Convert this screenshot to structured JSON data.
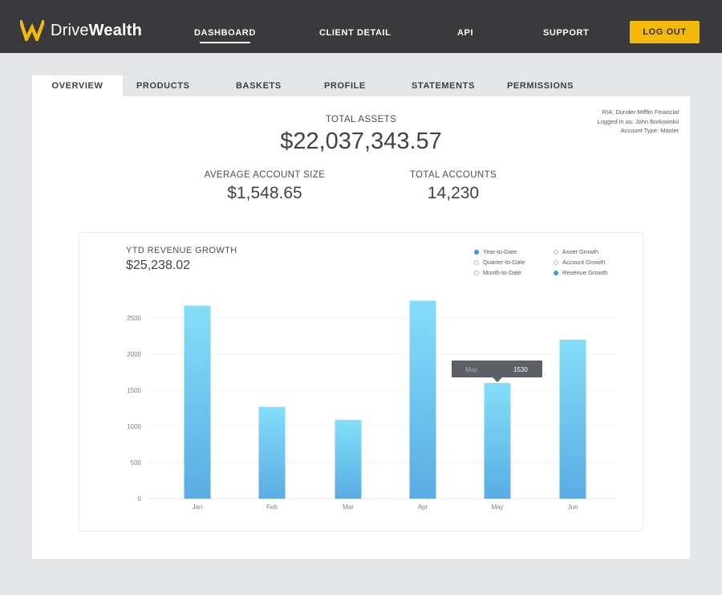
{
  "brand": {
    "name_light": "Drive",
    "name_bold": "Wealth",
    "accent": "#f6b90a"
  },
  "nav": {
    "links": [
      "DASHBOARD",
      "CLIENT DETAIL",
      "API",
      "SUPPORT"
    ],
    "active": "DASHBOARD",
    "logout_label": "LOG OUT"
  },
  "tabs": [
    "OVERVIEW",
    "PRODUCTS",
    "BASKETS",
    "PROFILE",
    "STATEMENTS",
    "PERMISSIONS"
  ],
  "active_tab": "OVERVIEW",
  "account": {
    "ria": "RIA: Dunder-Mifflin Financial",
    "logged_in": "Logged in as: John Borkowskil",
    "account_type": "Account Type: Master"
  },
  "summary": {
    "total_assets_label": "TOTAL ASSETS",
    "total_assets_value": "$22,037,343.57",
    "avg_size_label": "AVERAGE ACCOUNT SIZE",
    "avg_size_value": "$1,548.65",
    "total_accounts_label": "TOTAL ACCOUNTS",
    "total_accounts_value": "14,230"
  },
  "chart_header": {
    "title": "YTD REVENUE GROWTH",
    "value": "$25,238.02"
  },
  "legend": {
    "period_options": [
      {
        "label": "Year-to-Date",
        "selected": true
      },
      {
        "label": "Quarter-to-Date",
        "selected": false
      },
      {
        "label": "Month-to-Date",
        "selected": false
      }
    ],
    "metric_options": [
      {
        "label": "Asset Growth",
        "selected": false
      },
      {
        "label": "Account Growth",
        "selected": false
      },
      {
        "label": "Revenue Growth",
        "selected": true
      }
    ]
  },
  "tooltip": {
    "label": "May",
    "value": "1530"
  },
  "colors": {
    "bar_top": "#84def8",
    "bar_bottom": "#5aace4",
    "tooltip_bg": "#5b6068",
    "selected_dot": "#3c98dc"
  },
  "chart_data": {
    "type": "bar",
    "categories": [
      "Jan",
      "Feb",
      "Mar",
      "Apr",
      "May",
      "Jun"
    ],
    "values": [
      2670,
      1270,
      1090,
      2740,
      1600,
      2200
    ],
    "yticks": [
      0,
      500,
      1000,
      1500,
      2000,
      2500
    ],
    "ylim": [
      0,
      3000
    ],
    "grid": true,
    "xlabel": "",
    "ylabel": ""
  }
}
